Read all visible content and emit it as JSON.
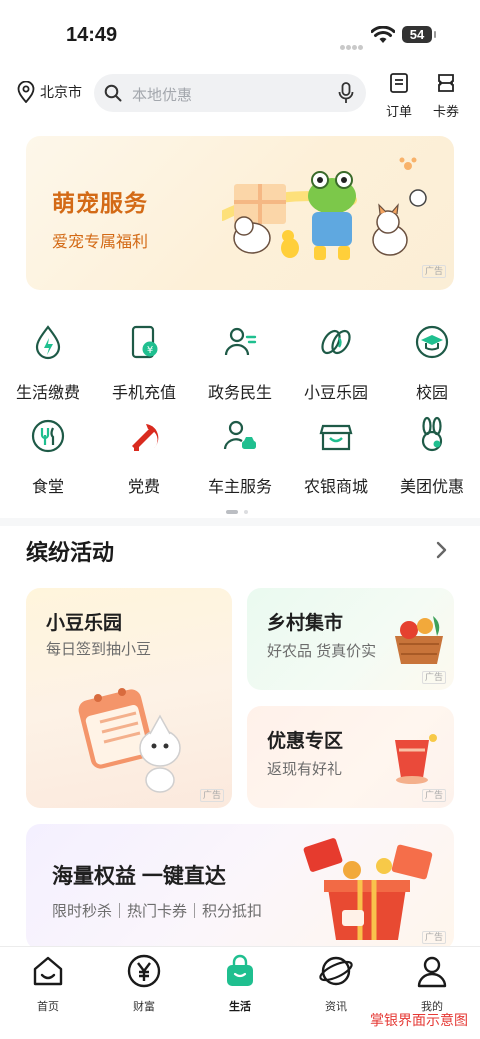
{
  "status": {
    "time": "14:49",
    "battery": "54"
  },
  "header": {
    "city": "北京市",
    "search_placeholder": "本地优惠",
    "orders_label": "订单",
    "cards_label": "卡券"
  },
  "banner": {
    "title": "萌宠服务",
    "subtitle": "爱宠专属福利",
    "ad_tag": "广告"
  },
  "services": [
    {
      "label": "生活缴费",
      "icon": "water-drop-bolt-icon"
    },
    {
      "label": "手机充值",
      "icon": "phone-recharge-icon"
    },
    {
      "label": "政务民生",
      "icon": "person-doc-icon"
    },
    {
      "label": "小豆乐园",
      "icon": "beans-icon"
    },
    {
      "label": "校园",
      "icon": "graduation-cap-icon"
    },
    {
      "label": "食堂",
      "icon": "cutlery-icon"
    },
    {
      "label": "党费",
      "icon": "party-emblem-icon"
    },
    {
      "label": "车主服务",
      "icon": "car-owner-icon"
    },
    {
      "label": "农银商城",
      "icon": "mall-store-icon"
    },
    {
      "label": "美团优惠",
      "icon": "meituan-rabbit-icon"
    }
  ],
  "activities": {
    "title": "缤纷活动",
    "cards": [
      {
        "title": "小豆乐园",
        "subtitle": "每日签到抽小豆",
        "ad_tag": "广告"
      },
      {
        "title": "乡村集市",
        "subtitle": "好农品 货真价实",
        "ad_tag": "广告"
      },
      {
        "title": "优惠专区",
        "subtitle": "返现有好礼",
        "ad_tag": "广告"
      },
      {
        "title": "海量权益 一键直达",
        "subtitle": "限时秒杀｜热门卡券｜积分抵扣",
        "ad_tag": "广告"
      }
    ]
  },
  "tabbar": [
    {
      "label": "首页"
    },
    {
      "label": "财富"
    },
    {
      "label": "生活"
    },
    {
      "label": "资讯"
    },
    {
      "label": "我的"
    }
  ],
  "watermark": "掌银界面示意图",
  "colors": {
    "brand_green": "#1fbf8f",
    "icon_green": "#2a8a6a",
    "party_red": "#d92b1f",
    "banner_orange": "#d36a16"
  }
}
